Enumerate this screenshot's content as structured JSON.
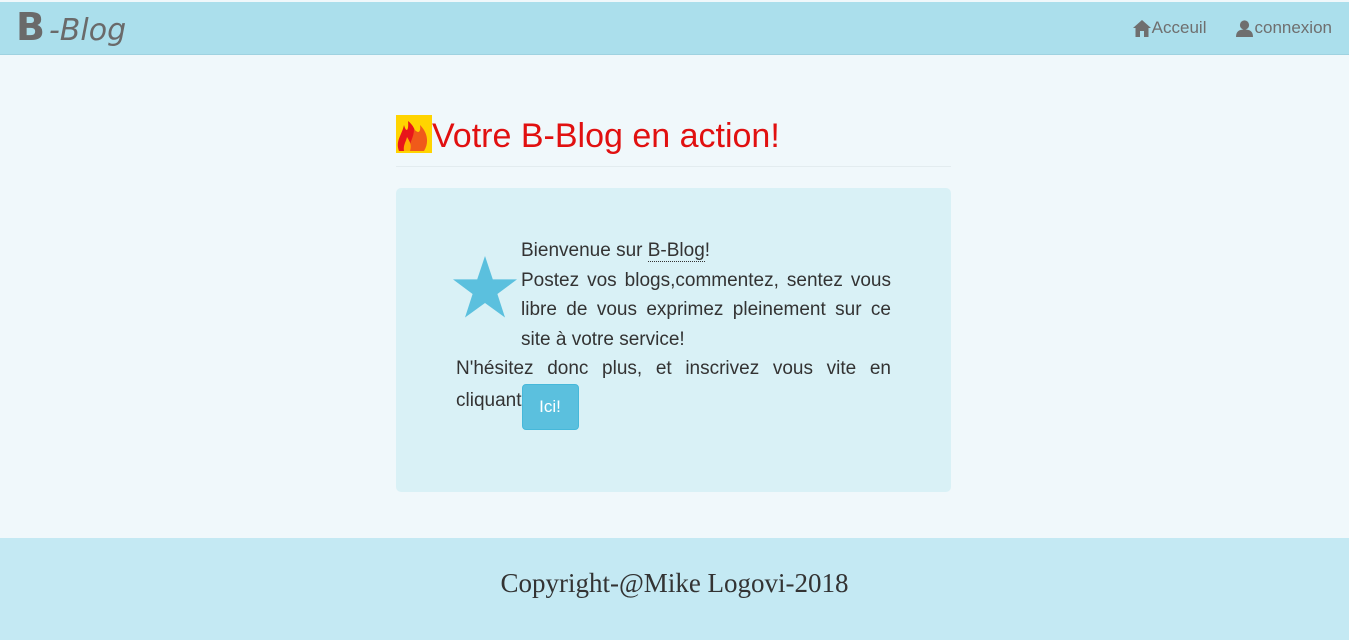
{
  "navbar": {
    "brand_letter": "B",
    "brand_rest": "-Blog",
    "links": [
      {
        "label": "Acceuil",
        "icon": "home-icon"
      },
      {
        "label": "connexion",
        "icon": "user-icon"
      }
    ]
  },
  "main": {
    "title": "Votre B-Blog en action!",
    "welcome_prefix": "Bienvenue sur ",
    "welcome_brand": "B-Blog",
    "welcome_suffix": "!",
    "paragraph": "Postez vos blogs,commentez, sentez vous libre de vous exprimez pleinement sur ce site à votre service!",
    "cta_line1": "N'hésitez donc plus, et inscrivez vous vite en",
    "cta_line2": "cliquant",
    "cta_button": "Ici!"
  },
  "footer": {
    "copyright": "Copyright-@Mike Logovi-2018"
  },
  "colors": {
    "navbar_bg": "#abdfec",
    "title": "#e11010",
    "well_bg": "#d9f1f6",
    "button": "#5bc0de",
    "footer_bg": "#c4e9f3",
    "star": "#5bc0de"
  }
}
